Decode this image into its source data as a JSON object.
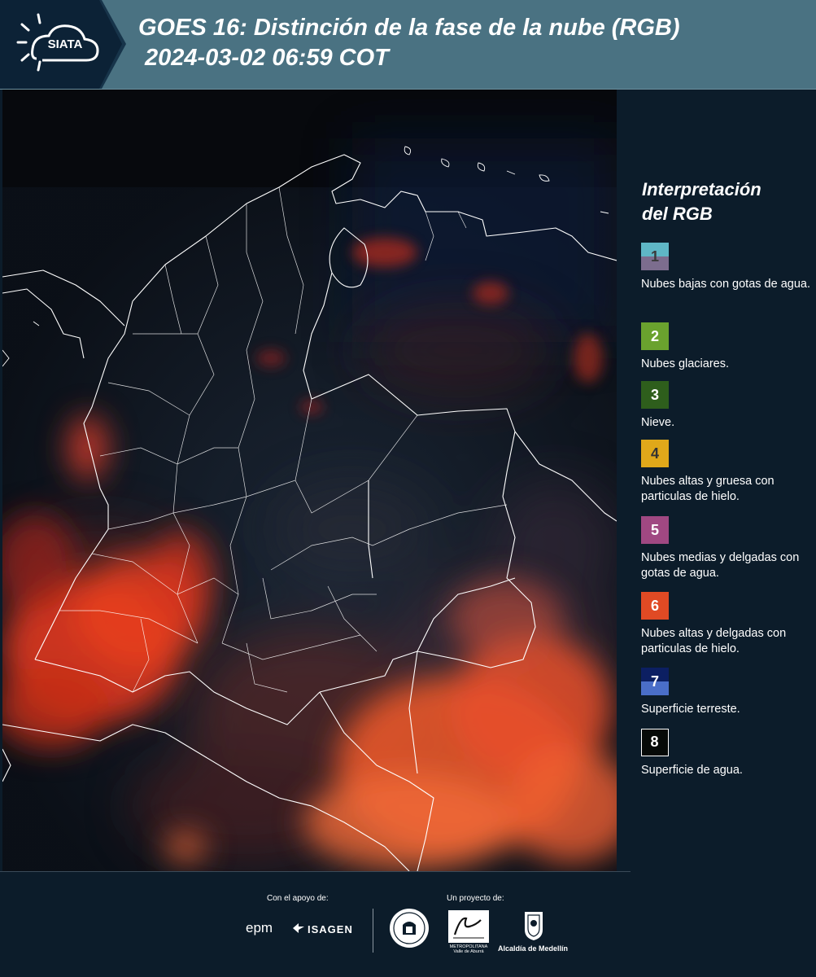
{
  "header": {
    "logo_text": "SIATA",
    "title": "GOES 16: Distinción de la fase de la nube (RGB)",
    "datetime": "2024-03-02 06:59 COT"
  },
  "legend": {
    "title_line1": "Interpretación",
    "title_line2": "del RGB",
    "items": [
      {
        "number": "1",
        "label": "Nubes bajas con gotas de agua.",
        "top_color": "#5fb7c6",
        "bottom_color": "#7c6d8e",
        "number_color": "#3a3a3a"
      },
      {
        "number": "2",
        "label": "Nubes glaciares.",
        "top_color": "#6aa22e",
        "bottom_color": "#6aa22e",
        "number_color": "#ffffff"
      },
      {
        "number": "3",
        "label": "Nieve.",
        "top_color": "#2e5e1c",
        "bottom_color": "#2e5e1c",
        "number_color": "#ffffff"
      },
      {
        "number": "4",
        "label": "Nubes altas y gruesa con particulas de hielo.",
        "top_color": "#e0a81a",
        "bottom_color": "#e0a81a",
        "number_color": "#333333"
      },
      {
        "number": "5",
        "label": "Nubes medias y delgadas con gotas de agua.",
        "top_color": "#a04882",
        "bottom_color": "#a04882",
        "number_color": "#ffffff"
      },
      {
        "number": "6",
        "label": "Nubes altas y delgadas con particulas de hielo.",
        "top_color": "#e04a24",
        "bottom_color": "#e04a24",
        "number_color": "#ffffff"
      },
      {
        "number": "7",
        "label": "Superficie terreste.",
        "top_color": "#0c1f62",
        "bottom_color": "#4a6ec8",
        "number_color": "#ffffff"
      },
      {
        "number": "8",
        "label": "Superficie de agua.",
        "top_color": "#060a08",
        "bottom_color": "#060a08",
        "number_color": "#ffffff",
        "border_color": "#ffffff"
      }
    ]
  },
  "footer": {
    "support_label": "Con el apoyo de:",
    "project_label": "Un proyecto de:",
    "sponsor_epm": "epm",
    "sponsor_isagen": "ISAGEN",
    "area_text": "METROPOLITANA Valle de Aburrá",
    "alcaldia": "Alcaldía de Medellín"
  },
  "colors": {
    "header_bg": "#4a7282",
    "page_bg": "#0c1c2a",
    "cloud_red": "#e8381c",
    "cloud_orange": "#f26a3a",
    "border_white": "#ffffff"
  }
}
